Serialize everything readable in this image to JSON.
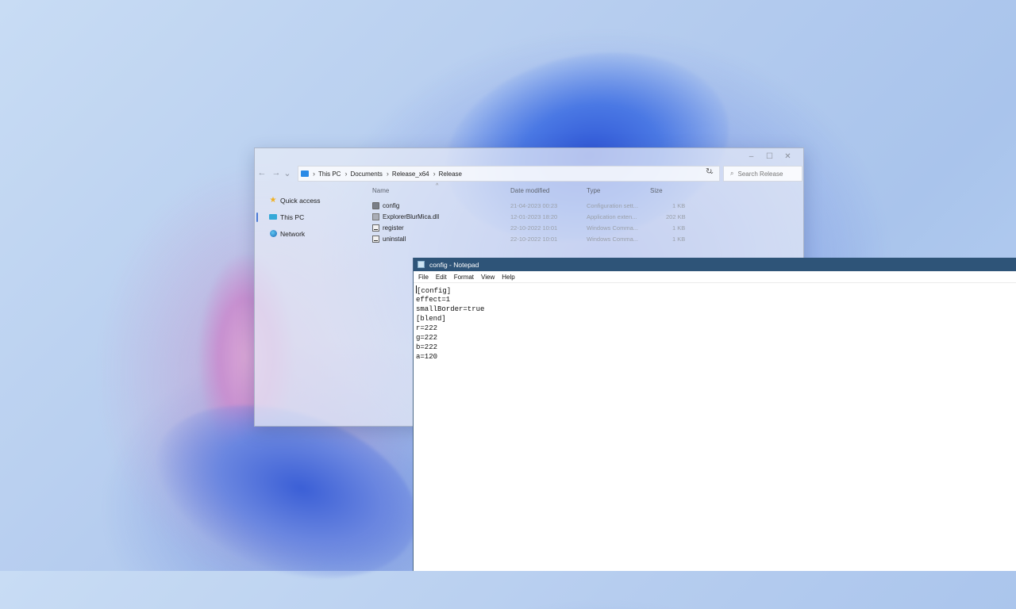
{
  "explorer": {
    "window_controls": [
      "–",
      "☐",
      "✕"
    ],
    "nav": {
      "back": "←",
      "forward": "→",
      "recent": "⌄",
      "up": "↑"
    },
    "breadcrumb": [
      "This PC",
      "Documents",
      "Release_x64",
      "Release"
    ],
    "refresh": "↻",
    "search_placeholder": "Search Release",
    "sidebar": [
      {
        "label": "Quick access",
        "icon": "star-icon"
      },
      {
        "label": "This PC",
        "icon": "computer-icon",
        "selected": true
      },
      {
        "label": "Network",
        "icon": "network-icon"
      }
    ],
    "columns": {
      "name": "Name",
      "date": "Date modified",
      "type": "Type",
      "size": "Size"
    },
    "files": [
      {
        "name": "config",
        "date": "21-04-2023 00:23",
        "type": "Configuration sett...",
        "size": "1 KB",
        "icon": "config-file-icon"
      },
      {
        "name": "ExplorerBlurMica.dll",
        "date": "12-01-2023 18:20",
        "type": "Application exten...",
        "size": "202 KB",
        "icon": "dll-file-icon"
      },
      {
        "name": "register",
        "date": "22-10-2022 10:01",
        "type": "Windows Comma...",
        "size": "1 KB",
        "icon": "cmd-file-icon"
      },
      {
        "name": "uninstall",
        "date": "22-10-2022 10:01",
        "type": "Windows Comma...",
        "size": "1 KB",
        "icon": "cmd-file-icon"
      }
    ]
  },
  "notepad": {
    "title": "config - Notepad",
    "menu": [
      "File",
      "Edit",
      "Format",
      "View",
      "Help"
    ],
    "lines": [
      "[config]",
      "effect=1",
      "smallBorder=true",
      "[blend]",
      "r=222",
      "g=222",
      "b=222",
      "a=120"
    ]
  }
}
